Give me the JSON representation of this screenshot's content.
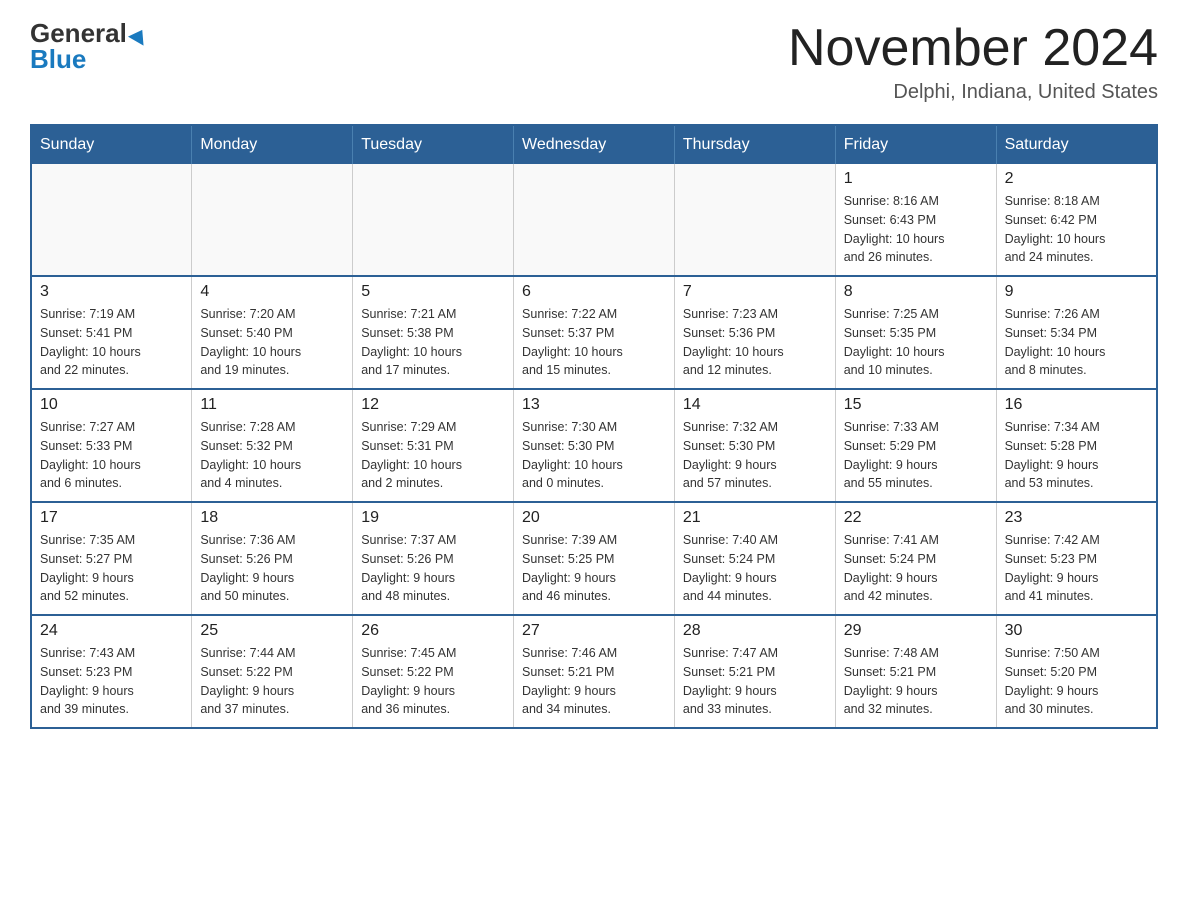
{
  "header": {
    "logo_line1": "General",
    "logo_line2": "Blue",
    "month_title": "November 2024",
    "location": "Delphi, Indiana, United States"
  },
  "calendar": {
    "weekdays": [
      "Sunday",
      "Monday",
      "Tuesday",
      "Wednesday",
      "Thursday",
      "Friday",
      "Saturday"
    ],
    "weeks": [
      [
        {
          "day": "",
          "info": ""
        },
        {
          "day": "",
          "info": ""
        },
        {
          "day": "",
          "info": ""
        },
        {
          "day": "",
          "info": ""
        },
        {
          "day": "",
          "info": ""
        },
        {
          "day": "1",
          "info": "Sunrise: 8:16 AM\nSunset: 6:43 PM\nDaylight: 10 hours\nand 26 minutes."
        },
        {
          "day": "2",
          "info": "Sunrise: 8:18 AM\nSunset: 6:42 PM\nDaylight: 10 hours\nand 24 minutes."
        }
      ],
      [
        {
          "day": "3",
          "info": "Sunrise: 7:19 AM\nSunset: 5:41 PM\nDaylight: 10 hours\nand 22 minutes."
        },
        {
          "day": "4",
          "info": "Sunrise: 7:20 AM\nSunset: 5:40 PM\nDaylight: 10 hours\nand 19 minutes."
        },
        {
          "day": "5",
          "info": "Sunrise: 7:21 AM\nSunset: 5:38 PM\nDaylight: 10 hours\nand 17 minutes."
        },
        {
          "day": "6",
          "info": "Sunrise: 7:22 AM\nSunset: 5:37 PM\nDaylight: 10 hours\nand 15 minutes."
        },
        {
          "day": "7",
          "info": "Sunrise: 7:23 AM\nSunset: 5:36 PM\nDaylight: 10 hours\nand 12 minutes."
        },
        {
          "day": "8",
          "info": "Sunrise: 7:25 AM\nSunset: 5:35 PM\nDaylight: 10 hours\nand 10 minutes."
        },
        {
          "day": "9",
          "info": "Sunrise: 7:26 AM\nSunset: 5:34 PM\nDaylight: 10 hours\nand 8 minutes."
        }
      ],
      [
        {
          "day": "10",
          "info": "Sunrise: 7:27 AM\nSunset: 5:33 PM\nDaylight: 10 hours\nand 6 minutes."
        },
        {
          "day": "11",
          "info": "Sunrise: 7:28 AM\nSunset: 5:32 PM\nDaylight: 10 hours\nand 4 minutes."
        },
        {
          "day": "12",
          "info": "Sunrise: 7:29 AM\nSunset: 5:31 PM\nDaylight: 10 hours\nand 2 minutes."
        },
        {
          "day": "13",
          "info": "Sunrise: 7:30 AM\nSunset: 5:30 PM\nDaylight: 10 hours\nand 0 minutes."
        },
        {
          "day": "14",
          "info": "Sunrise: 7:32 AM\nSunset: 5:30 PM\nDaylight: 9 hours\nand 57 minutes."
        },
        {
          "day": "15",
          "info": "Sunrise: 7:33 AM\nSunset: 5:29 PM\nDaylight: 9 hours\nand 55 minutes."
        },
        {
          "day": "16",
          "info": "Sunrise: 7:34 AM\nSunset: 5:28 PM\nDaylight: 9 hours\nand 53 minutes."
        }
      ],
      [
        {
          "day": "17",
          "info": "Sunrise: 7:35 AM\nSunset: 5:27 PM\nDaylight: 9 hours\nand 52 minutes."
        },
        {
          "day": "18",
          "info": "Sunrise: 7:36 AM\nSunset: 5:26 PM\nDaylight: 9 hours\nand 50 minutes."
        },
        {
          "day": "19",
          "info": "Sunrise: 7:37 AM\nSunset: 5:26 PM\nDaylight: 9 hours\nand 48 minutes."
        },
        {
          "day": "20",
          "info": "Sunrise: 7:39 AM\nSunset: 5:25 PM\nDaylight: 9 hours\nand 46 minutes."
        },
        {
          "day": "21",
          "info": "Sunrise: 7:40 AM\nSunset: 5:24 PM\nDaylight: 9 hours\nand 44 minutes."
        },
        {
          "day": "22",
          "info": "Sunrise: 7:41 AM\nSunset: 5:24 PM\nDaylight: 9 hours\nand 42 minutes."
        },
        {
          "day": "23",
          "info": "Sunrise: 7:42 AM\nSunset: 5:23 PM\nDaylight: 9 hours\nand 41 minutes."
        }
      ],
      [
        {
          "day": "24",
          "info": "Sunrise: 7:43 AM\nSunset: 5:23 PM\nDaylight: 9 hours\nand 39 minutes."
        },
        {
          "day": "25",
          "info": "Sunrise: 7:44 AM\nSunset: 5:22 PM\nDaylight: 9 hours\nand 37 minutes."
        },
        {
          "day": "26",
          "info": "Sunrise: 7:45 AM\nSunset: 5:22 PM\nDaylight: 9 hours\nand 36 minutes."
        },
        {
          "day": "27",
          "info": "Sunrise: 7:46 AM\nSunset: 5:21 PM\nDaylight: 9 hours\nand 34 minutes."
        },
        {
          "day": "28",
          "info": "Sunrise: 7:47 AM\nSunset: 5:21 PM\nDaylight: 9 hours\nand 33 minutes."
        },
        {
          "day": "29",
          "info": "Sunrise: 7:48 AM\nSunset: 5:21 PM\nDaylight: 9 hours\nand 32 minutes."
        },
        {
          "day": "30",
          "info": "Sunrise: 7:50 AM\nSunset: 5:20 PM\nDaylight: 9 hours\nand 30 minutes."
        }
      ]
    ]
  }
}
